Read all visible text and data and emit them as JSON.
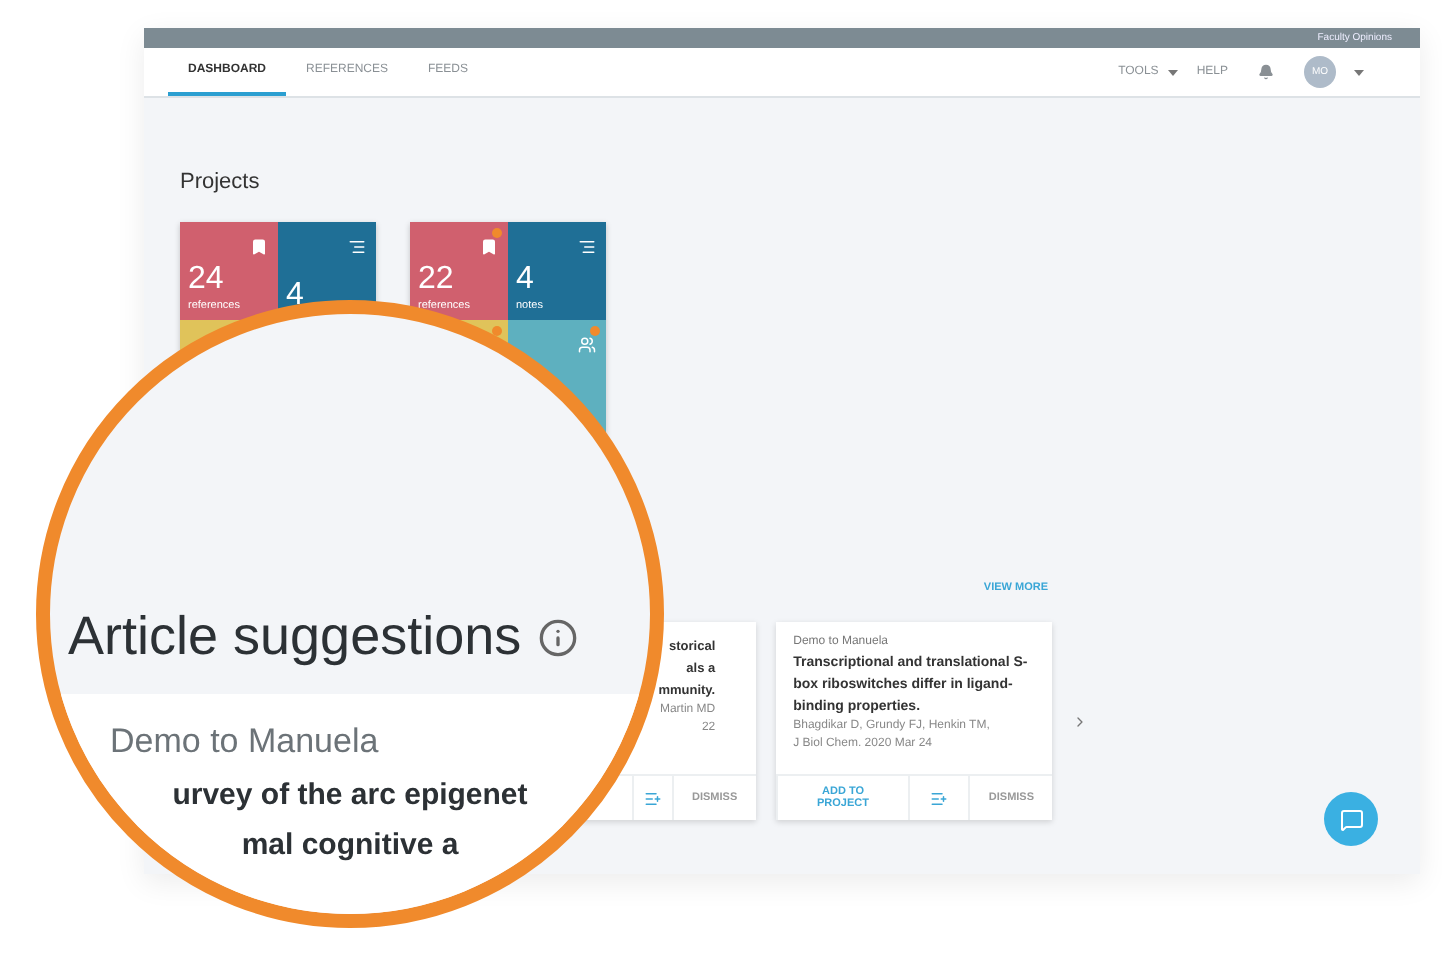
{
  "topbar": {
    "brand": "Faculty Opinions"
  },
  "nav": {
    "tabs": [
      {
        "label": "DASHBOARD",
        "selected": true
      },
      {
        "label": "REFERENCES",
        "selected": false
      },
      {
        "label": "FEEDS",
        "selected": false
      }
    ],
    "tools": "TOOLS",
    "help": "HELP",
    "avatar": "MO"
  },
  "projects": {
    "title": "Projects",
    "cards": [
      {
        "tiles": [
          {
            "kind": "references",
            "count": "24",
            "label": "references",
            "color": "#d0606e",
            "badge": false
          },
          {
            "kind": "notes",
            "count": "4",
            "color": "#1f6f96",
            "badge": false
          },
          {
            "kind": "other",
            "color": "#e0c35a",
            "badge": false
          }
        ]
      },
      {
        "tiles": [
          {
            "kind": "references",
            "count": "22",
            "label": "references",
            "color": "#d0606e",
            "badge": true
          },
          {
            "kind": "notes",
            "count": "4",
            "label": "notes",
            "color": "#1f6f96",
            "badge": false
          },
          {
            "kind": "other",
            "color": "#e0c35a",
            "badge": true
          },
          {
            "kind": "members",
            "color": "#5eb0bf",
            "badge": true
          }
        ]
      }
    ]
  },
  "suggestions": {
    "view_more": "VIEW MORE",
    "cards": [
      {
        "title_lines": [
          "storical",
          "als a",
          "mmunity."
        ],
        "authors": "Martin MD",
        "journal": "22",
        "dismiss": "DISMISS"
      },
      {
        "source": "Demo to Manuela",
        "title_lines": [
          "Transcriptional and translational S-",
          "box riboswitches differ in ligand-",
          "binding properties."
        ],
        "authors": "Bhagdikar D, Grundy FJ, Henkin TM,",
        "journal": "J Biol Chem. 2020 Mar 24",
        "add": "ADD TO PROJECT",
        "dismiss": "DISMISS"
      }
    ]
  },
  "magnifier": {
    "heading": "Article suggestions",
    "source": "Demo to Manuela",
    "title_lines": [
      "urvey of the arc epigenet",
      "mal cognitive a"
    ]
  }
}
